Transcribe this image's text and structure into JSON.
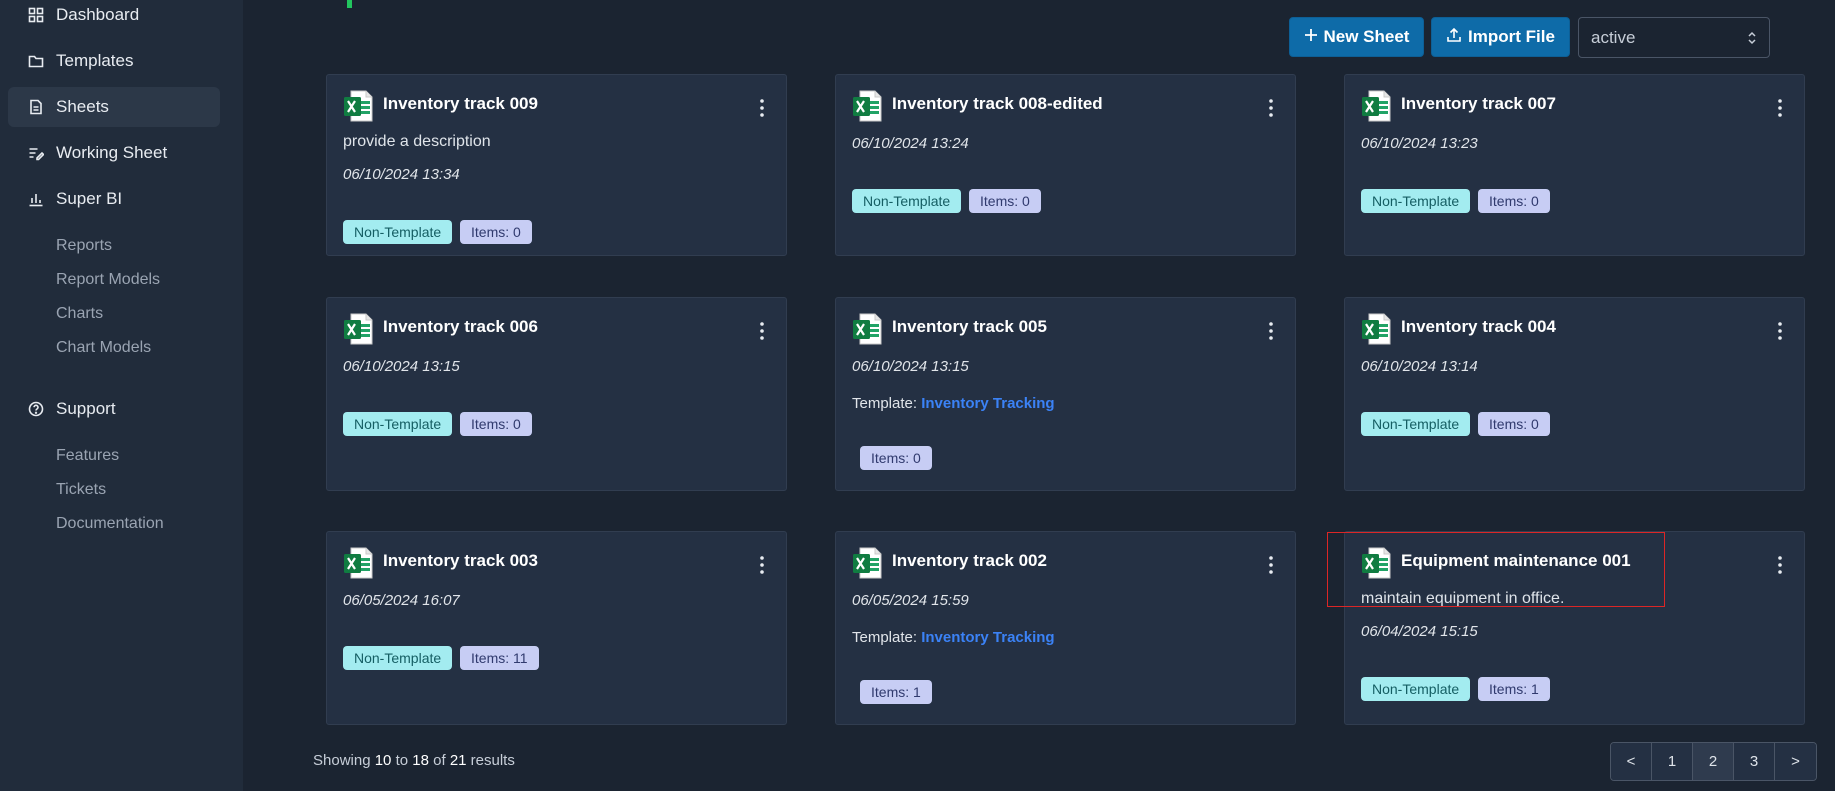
{
  "sidebar": {
    "items": [
      {
        "label": "Dashboard",
        "icon": "grid-icon"
      },
      {
        "label": "Templates",
        "icon": "folder-icon"
      },
      {
        "label": "Sheets",
        "icon": "document-icon",
        "active": true
      },
      {
        "label": "Working Sheet",
        "icon": "edit-list-icon"
      },
      {
        "label": "Super BI",
        "icon": "bar-chart-icon"
      }
    ],
    "superbi_sub": [
      "Reports",
      "Report Models",
      "Charts",
      "Chart Models"
    ],
    "support_label": "Support",
    "support_icon": "help-circle-icon",
    "support_sub": [
      "Features",
      "Tickets",
      "Documentation"
    ]
  },
  "toolbar": {
    "new_sheet_label": "New Sheet",
    "import_file_label": "Import File",
    "status_select_value": "active"
  },
  "cards": [
    {
      "title": "Inventory track 009",
      "description": "provide a description",
      "date": "06/10/2024 13:34",
      "type_badge": "Non-Template",
      "items_badge": "Items: 0"
    },
    {
      "title": "Inventory track 008-edited",
      "date": "06/10/2024 13:24",
      "type_badge": "Non-Template",
      "items_badge": "Items: 0"
    },
    {
      "title": "Inventory track 007",
      "date": "06/10/2024 13:23",
      "type_badge": "Non-Template",
      "items_badge": "Items: 0"
    },
    {
      "title": "Inventory track 006",
      "date": "06/10/2024 13:15",
      "type_badge": "Non-Template",
      "items_badge": "Items: 0"
    },
    {
      "title": "Inventory track 005",
      "date": "06/10/2024 13:15",
      "template_prefix": "Template:",
      "template_name": "Inventory Tracking",
      "items_badge": "Items: 0"
    },
    {
      "title": "Inventory track 004",
      "date": "06/10/2024 13:14",
      "type_badge": "Non-Template",
      "items_badge": "Items: 0"
    },
    {
      "title": "Inventory track 003",
      "date": "06/05/2024 16:07",
      "type_badge": "Non-Template",
      "items_badge": "Items: 11"
    },
    {
      "title": "Inventory track 002",
      "date": "06/05/2024 15:59",
      "template_prefix": "Template:",
      "template_name": "Inventory Tracking",
      "items_badge": "Items: 1"
    },
    {
      "title": "Equipment maintenance 001",
      "description": "maintain equipment in office.",
      "date": "06/04/2024 15:15",
      "type_badge": "Non-Template",
      "items_badge": "Items: 1"
    }
  ],
  "footer": {
    "showing_prefix": "Showing",
    "from": "10",
    "to_word": "to",
    "to": "18",
    "of_word": "of",
    "total": "21",
    "results_word": "results"
  },
  "pagination": {
    "prev": "<",
    "pages": [
      "1",
      "2",
      "3"
    ],
    "current": "2",
    "next": ">"
  },
  "colors": {
    "accent": "#0e6ba8",
    "non_template_badge": "#a3ecf0",
    "items_badge": "#c7cdf4",
    "template_link": "#3b82f6"
  }
}
